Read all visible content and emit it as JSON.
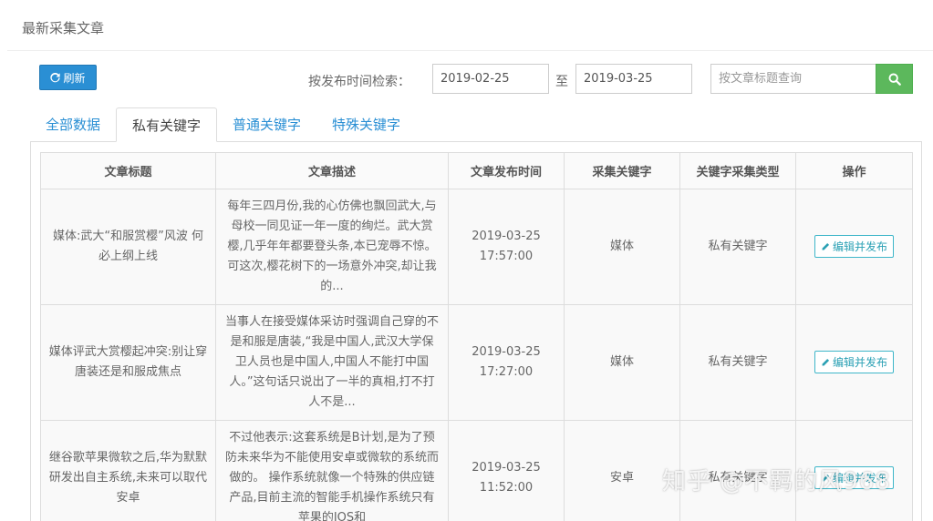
{
  "page": {
    "title": "最新采集文章"
  },
  "toolbar": {
    "refresh_label": "刷新",
    "search_label": "按发布时间检索：",
    "date_from": "2019-02-25",
    "to_label": "至",
    "date_to": "2019-03-25",
    "title_placeholder": "按文章标题查询"
  },
  "tabs": [
    {
      "label": "全部数据",
      "active": false
    },
    {
      "label": "私有关键字",
      "active": true
    },
    {
      "label": "普通关键字",
      "active": false
    },
    {
      "label": "特殊关键字",
      "active": false
    }
  ],
  "table": {
    "headers": [
      "文章标题",
      "文章描述",
      "文章发布时间",
      "采集关键字",
      "关键字采集类型",
      "操作"
    ],
    "rows": [
      {
        "title": "媒体:武大“和服赏樱”风波 何必上纲上线",
        "desc": "每年三四月份,我的心仿佛也飘回武大,与母校一同见证一年一度的绚烂。武大赏樱,几乎年年都要登头条,本已宠辱不惊。可这次,樱花树下的一场意外冲突,却让我的...",
        "time": "2019-03-25 17:57:00",
        "keyword": "媒体",
        "type": "私有关键字",
        "action": "编辑并发布"
      },
      {
        "title": "媒体评武大赏樱起冲突:别让穿唐装还是和服成焦点",
        "desc": "当事人在接受媒体采访时强调自己穿的不是和服是唐装,“我是中国人,武汉大学保卫人员也是中国人,中国人不能打中国人。”这句话只说出了一半的真相,打不打人不是...",
        "time": "2019-03-25 17:27:00",
        "keyword": "媒体",
        "type": "私有关键字",
        "action": "编辑并发布"
      },
      {
        "title": "继谷歌苹果微软之后,华为默默研发出自主系统,未来可以取代安卓",
        "desc": "不过他表示:这套系统是B计划,是为了预防未来华为不能使用安卓或微软的系统而做的。 操作系统就像一个特殊的供应链产品,目前主流的智能手机操作系统只有苹果的IOS和",
        "time": "2019-03-25 11:52:00",
        "keyword": "安卓",
        "type": "私有关键字",
        "action": "编辑并发布"
      }
    ]
  },
  "watermark": "知乎 @不羁的风968",
  "colors": {
    "primary": "#2a8fd4",
    "success": "#5cb85c",
    "info": "#3fb6c9"
  }
}
